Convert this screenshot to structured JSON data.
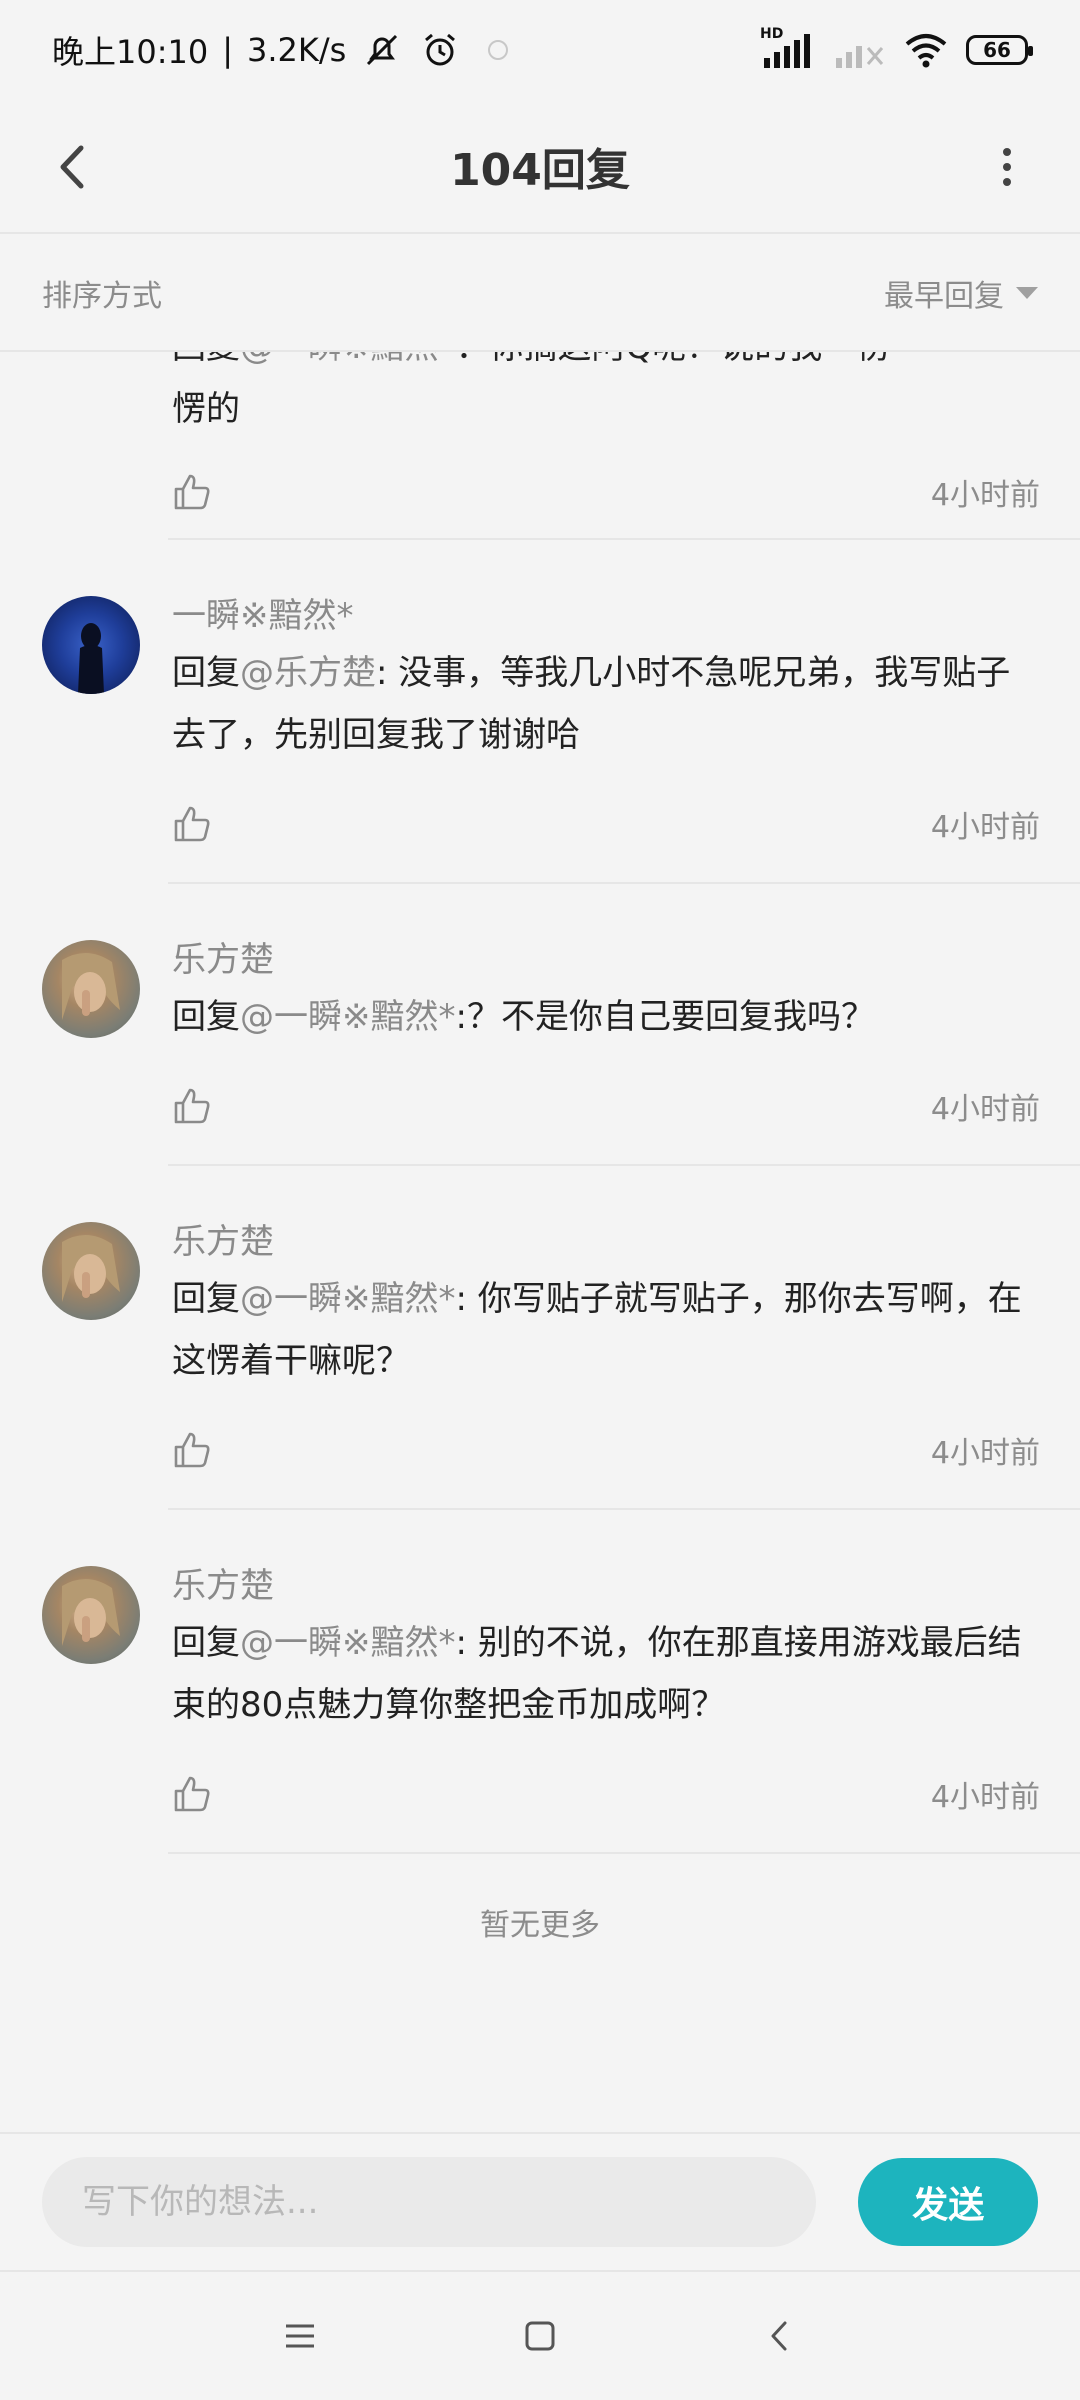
{
  "status_bar": {
    "time": "晚上10:10",
    "network_speed": "3.2K/s",
    "hd_label": "HD",
    "battery": "66"
  },
  "header": {
    "title": "104回复"
  },
  "sort": {
    "label": "排序方式",
    "selected": "最早回复"
  },
  "partial_comment": {
    "prefix": "回复",
    "mention": "@一瞬※黯然*",
    "text": "：你搞这阿Q呢？说的我一愣",
    "text2": "愣的",
    "time": "4小时前"
  },
  "comments": [
    {
      "username": "一瞬※黯然*",
      "prefix": "回复",
      "mention": "@乐方楚",
      "text": ": 没事，等我几小时不急呢兄弟，我写贴子去了，先别回复我了谢谢哈",
      "time": "4小时前"
    },
    {
      "username": "乐方楚",
      "prefix": "回复",
      "mention": "@一瞬※黯然*",
      "text": ":？不是你自己要回复我吗？",
      "time": "4小时前"
    },
    {
      "username": "乐方楚",
      "prefix": "回复",
      "mention": "@一瞬※黯然*",
      "text": ": 你写贴子就写贴子，那你去写啊，在这愣着干嘛呢？",
      "time": "4小时前"
    },
    {
      "username": "乐方楚",
      "prefix": "回复",
      "mention": "@一瞬※黯然*",
      "text": ": 别的不说，你在那直接用游戏最后结束的80点魅力算你整把金币加成啊？",
      "time": "4小时前"
    }
  ],
  "no_more": "暂无更多",
  "input": {
    "placeholder": "写下你的想法...",
    "send_label": "发送"
  },
  "colors": {
    "accent": "#1db4be",
    "background": "#f4f4f4",
    "muted_text": "#8a8a8a"
  }
}
